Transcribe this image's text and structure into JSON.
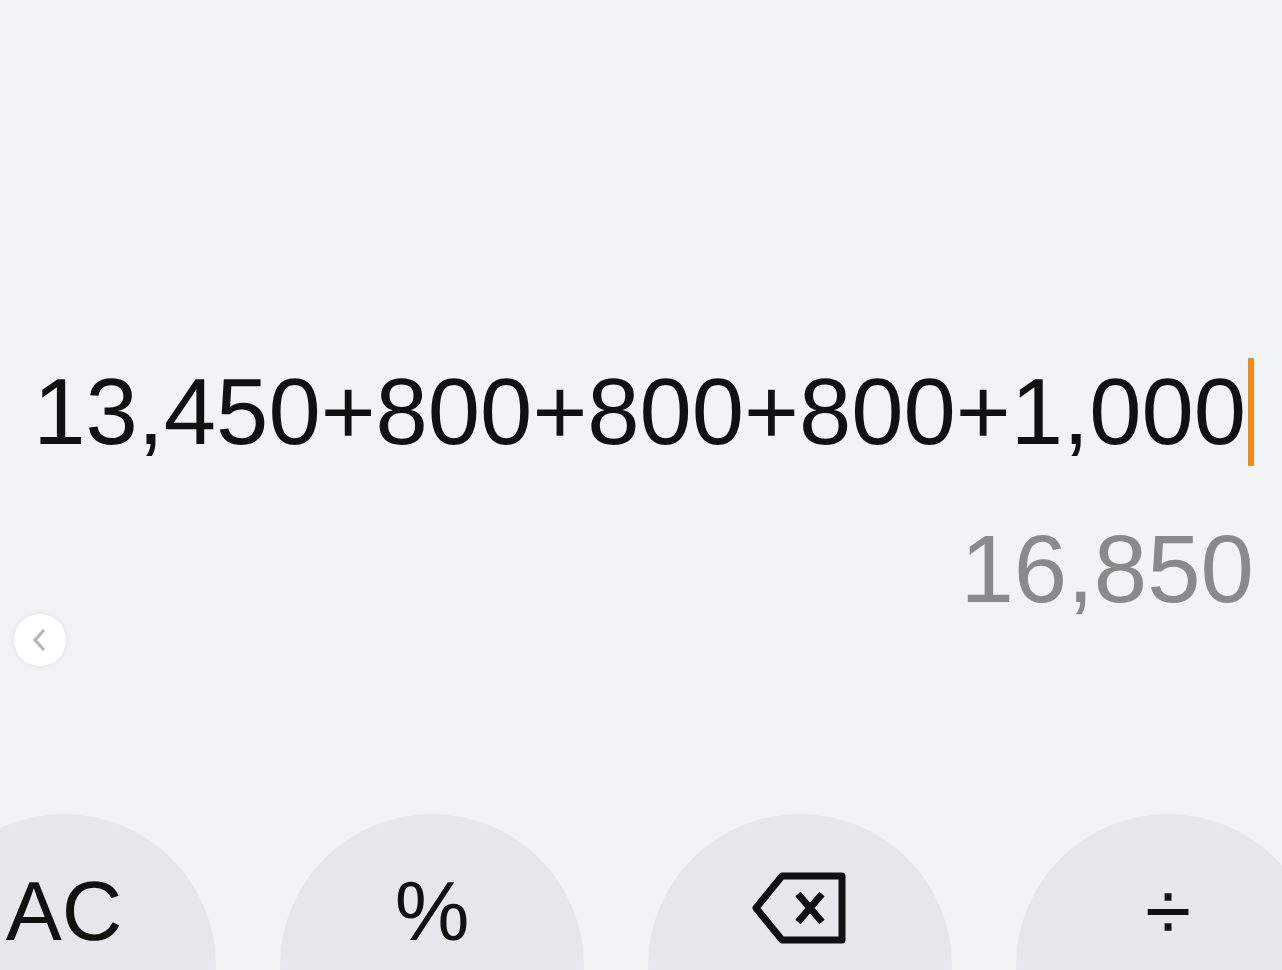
{
  "display": {
    "expression": "13,450+800+800+800+1,000",
    "result": "16,850"
  },
  "keys": [
    {
      "kind": "text",
      "label": "AC"
    },
    {
      "kind": "text",
      "label": "%"
    },
    {
      "kind": "backspace"
    },
    {
      "kind": "text",
      "label": "÷"
    }
  ]
}
